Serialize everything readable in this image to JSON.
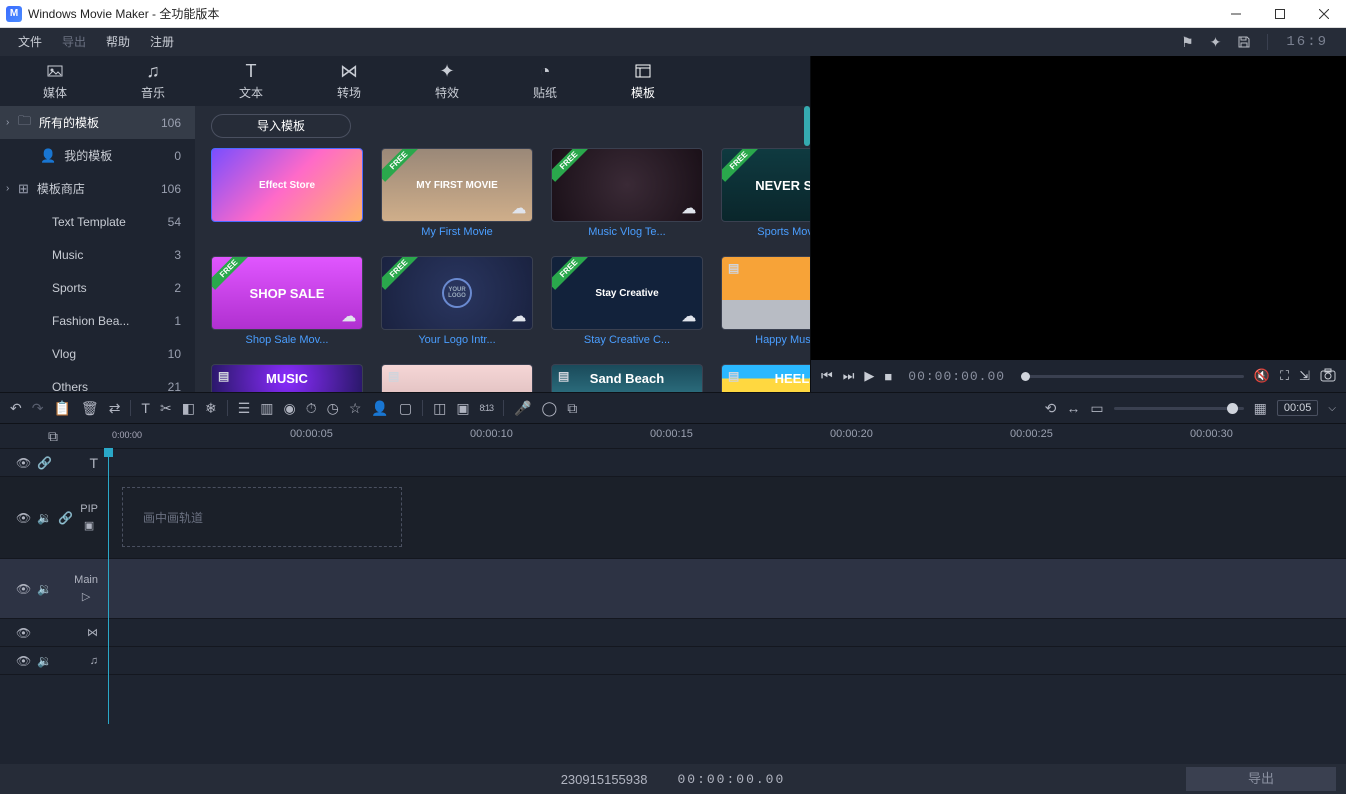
{
  "title": "Windows Movie Maker  - 全功能版本",
  "app_icon_letter": "M",
  "menu": {
    "file": "文件",
    "export": "导出",
    "help": "帮助",
    "register": "注册"
  },
  "aspect_label": "16:9",
  "main_tabs": [
    {
      "label": "媒体"
    },
    {
      "label": "音乐"
    },
    {
      "label": "文本"
    },
    {
      "label": "转场"
    },
    {
      "label": "特效"
    },
    {
      "label": "贴纸"
    },
    {
      "label": "模板"
    }
  ],
  "sidebar": [
    {
      "glyph": "folder",
      "chev": "›",
      "label": "所有的模板",
      "count": "106",
      "selected": true
    },
    {
      "glyph": "person",
      "label": "我的模板",
      "count": "0",
      "indent": true
    },
    {
      "glyph": "grid",
      "chev": "›",
      "label": "模板商店",
      "count": "106"
    },
    {
      "label": "Text Template",
      "count": "54",
      "indent2": true
    },
    {
      "label": "Music",
      "count": "3",
      "indent2": true,
      "arrow": true
    },
    {
      "label": "Sports",
      "count": "2",
      "indent2": true
    },
    {
      "label": "Fashion Bea...",
      "count": "1",
      "indent2": true
    },
    {
      "label": "Vlog",
      "count": "10",
      "indent2": true
    },
    {
      "label": "Others",
      "count": "21",
      "indent2": true
    }
  ],
  "import_button": "导入模板",
  "templates": [
    {
      "label": "",
      "thumb_text": "Effect  Store",
      "bg": "linear-gradient(135deg,#7a4eff,#ff6ac8,#ffb16a)",
      "free": false
    },
    {
      "label": "My First Movie",
      "thumb_text": "MY FIRST MOVIE",
      "bg": "linear-gradient(#9a8878,#cfae8a)",
      "free": true
    },
    {
      "label": "Music Vlog Te...",
      "thumb_text": "",
      "bg": "radial-gradient(circle,#3a2a36,#1a1018)",
      "free": true
    },
    {
      "label": "Sports Movie I...",
      "thumb_text": "NEVER STOP",
      "bg": "linear-gradient(#0f3a40,#0a262b)",
      "free": true
    },
    {
      "label": "Shop Sale Mov...",
      "thumb_text": "SHOP SALE",
      "bg": "linear-gradient(#e056ff,#b030d0)",
      "free": true
    },
    {
      "label": "Your Logo Intr...",
      "thumb_text": "",
      "bg": "radial-gradient(circle at center,#2a3660,#1a2240)",
      "free": true,
      "circle": true
    },
    {
      "label": "Stay Creative C...",
      "thumb_text": "Stay Creative",
      "bg": "linear-gradient(rgba(10,30,60,.7),rgba(10,30,60,.7))",
      "free": true
    },
    {
      "label": "Happy Music D...",
      "thumb_text": "",
      "bg": "linear-gradient(#f7a338 60%,#b8bcc4 60%)",
      "free": false
    },
    {
      "label": "",
      "thumb_text": "MUSIC",
      "bg": "radial-gradient(circle,#8a2cff,#2a186a)",
      "free": false,
      "partial": true
    },
    {
      "label": "",
      "thumb_text": "",
      "bg": "linear-gradient(#f5d6d6,#e5c5c5)",
      "free": false,
      "partial": true
    },
    {
      "label": "",
      "thumb_text": "Sand Beach",
      "bg": "linear-gradient(#1a4a5a,#2a6a7a)",
      "free": false,
      "partial": true
    },
    {
      "label": "",
      "thumb_text": "HEELO",
      "bg": "linear-gradient(#2ab8ff 50%,#ffd840 50%)",
      "free": false,
      "partial": true
    }
  ],
  "preview": {
    "timecode": "00:00:00.00",
    "vol_icon": "🔇"
  },
  "toolbar_time": "00:05",
  "ruler": {
    "start_small": "0:00:00",
    "ticks": [
      "00:00:05",
      "00:00:10",
      "00:00:15",
      "00:00:20",
      "00:00:25",
      "00:00:30"
    ]
  },
  "tracks": {
    "pip_label": "PIP",
    "pip_placeholder": "画中画轨道",
    "main_label": "Main"
  },
  "status": {
    "code": "230915155938",
    "timecode": "00:00:00.00",
    "export": "导出"
  }
}
